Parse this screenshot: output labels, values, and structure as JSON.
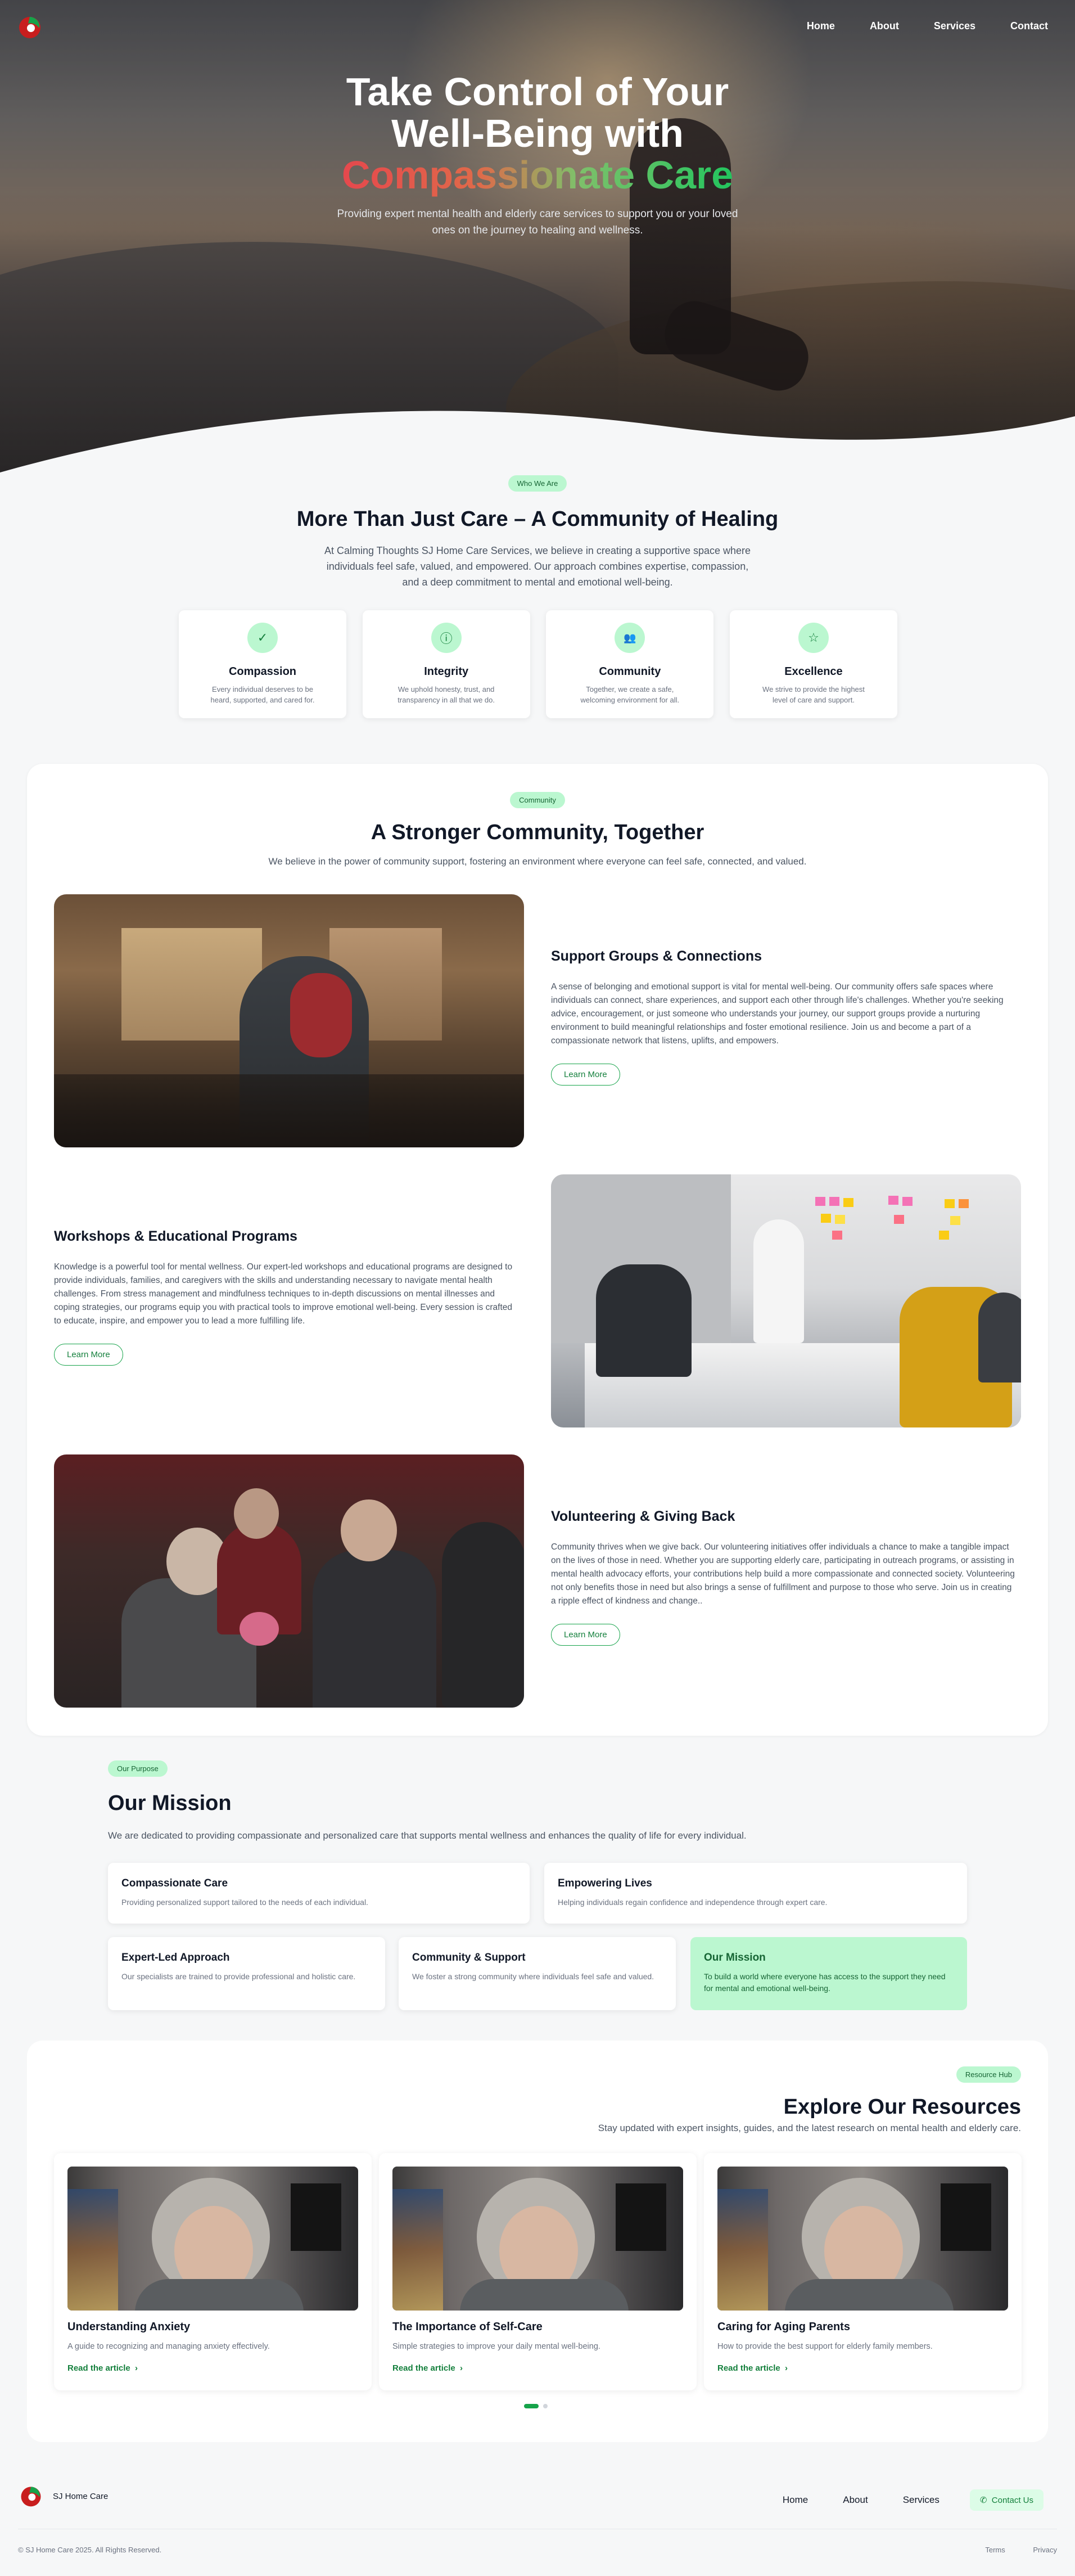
{
  "header": {
    "nav": [
      "Home",
      "About",
      "Services",
      "Contact"
    ]
  },
  "hero": {
    "title_line1": "Take Control of Your",
    "title_line2": "Well-Being with",
    "title_highlight": "Compassionate Care",
    "subtitle": "Providing expert mental health and elderly care services to support you or your loved ones on the journey to healing and wellness."
  },
  "who": {
    "pill": "Who We Are",
    "title": "More Than Just Care – A Community of Healing",
    "lead": "At Calming Thoughts SJ Home Care Services, we believe in creating a supportive space where individuals feel safe, valued, and empowered. Our approach combines expertise, compassion, and a deep commitment to mental and emotional well-being.",
    "values": [
      {
        "icon": "check-icon",
        "glyph": "✓",
        "title": "Compassion",
        "text": "Every individual deserves to be heard, supported, and cared for."
      },
      {
        "icon": "info-icon",
        "glyph": "ⓘ",
        "title": "Integrity",
        "text": "We uphold honesty, trust, and transparency in all that we do."
      },
      {
        "icon": "users-icon",
        "glyph": "👥",
        "title": "Community",
        "text": "Together, we create a safe, welcoming environment for all."
      },
      {
        "icon": "star-icon",
        "glyph": "☆",
        "title": "Excellence",
        "text": "We strive to provide the highest level of care and support."
      }
    ]
  },
  "community": {
    "pill": "Community",
    "title": "A Stronger Community, Together",
    "subtitle": "We believe in the power of community support, fostering an environment where everyone can feel safe, connected, and valued.",
    "items": [
      {
        "title": "Support Groups & Connections",
        "text": "A sense of belonging and emotional support is vital for mental well-being. Our community offers safe spaces where individuals can connect, share experiences, and support each other through life's challenges. Whether you're seeking advice, encouragement, or just someone who understands your journey, our support groups provide a nurturing environment to build meaningful relationships and foster emotional resilience. Join us and become a part of a compassionate network that listens, uplifts, and empowers.",
        "button": "Learn More"
      },
      {
        "title": "Workshops & Educational Programs",
        "text": "Knowledge is a powerful tool for mental wellness. Our expert-led workshops and educational programs are designed to provide individuals, families, and caregivers with the skills and understanding necessary to navigate mental health challenges. From stress management and mindfulness techniques to in-depth discussions on mental illnesses and coping strategies, our programs equip you with practical tools to improve emotional well-being. Every session is crafted to educate, inspire, and empower you to lead a more fulfilling life.",
        "button": "Learn More"
      },
      {
        "title": "Volunteering & Giving Back",
        "text": "Community thrives when we give back. Our volunteering initiatives offer individuals a chance to make a tangible impact on the lives of those in need. Whether you are supporting elderly care, participating in outreach programs, or assisting in mental health advocacy efforts, your contributions help build a more compassionate and connected society. Volunteering not only benefits those in need but also brings a sense of fulfillment and purpose to those who serve. Join us in creating a ripple effect of kindness and change..",
        "button": "Learn More"
      }
    ]
  },
  "mission": {
    "pill": "Our Purpose",
    "title": "Our Mission",
    "subtitle": "We are dedicated to providing compassionate and personalized care that supports mental wellness and enhances the quality of life for every individual.",
    "cards": [
      {
        "title": "Compassionate Care",
        "text": "Providing personalized support tailored to the needs of each individual."
      },
      {
        "title": "Empowering Lives",
        "text": "Helping individuals regain confidence and independence through expert care."
      },
      {
        "title": "Expert-Led Approach",
        "text": "Our specialists are trained to provide professional and holistic care."
      },
      {
        "title": "Community & Support",
        "text": "We foster a strong community where individuals feel safe and valued."
      },
      {
        "title": "Our Mission",
        "text": "To build a world where everyone has access to the support they need for mental and emotional well-being."
      }
    ]
  },
  "resources": {
    "pill": "Resource Hub",
    "title": "Explore Our Resources",
    "subtitle": "Stay updated with expert insights, guides, and the latest research on mental health and elderly care.",
    "articles": [
      {
        "title": "Understanding Anxiety",
        "text": "A guide to recognizing and managing anxiety effectively.",
        "link": "Read the article"
      },
      {
        "title": "The Importance of Self-Care",
        "text": "Simple strategies to improve your daily mental well-being.",
        "link": "Read the article"
      },
      {
        "title": "Caring for Aging Parents",
        "text": "How to provide the best support for elderly family members.",
        "link": "Read the article"
      }
    ]
  },
  "footer": {
    "brand": "SJ Home Care",
    "nav": [
      "Home",
      "About",
      "Services"
    ],
    "contact": "Contact Us",
    "copyright": "© SJ Home Care 2025. All Rights Reserved.",
    "legal": [
      "Terms",
      "Privacy"
    ]
  },
  "colors": {
    "accent": "#16a34a",
    "accent_light": "#bbf7d0",
    "gradient_start": "#e5484d",
    "gradient_end": "#22c55e"
  }
}
